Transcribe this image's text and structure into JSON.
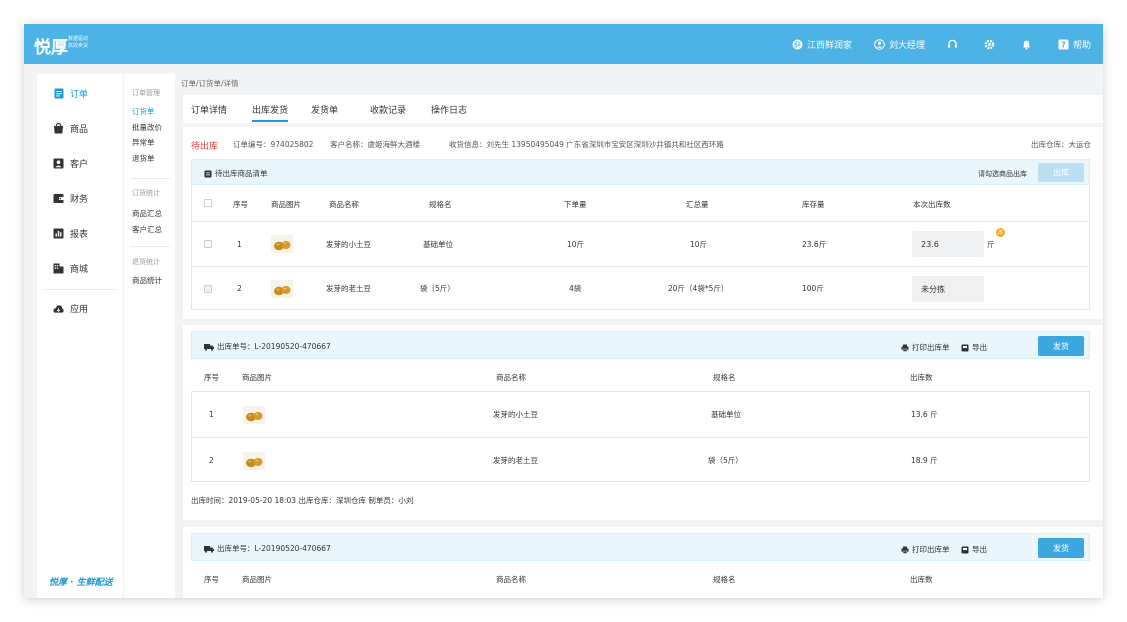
{
  "app": {
    "logo": "悦厚",
    "logo_sub_1": "数据驱动",
    "logo_sub_2": "高效卖货",
    "footer_brand": "悦厚 · 生鲜配送"
  },
  "topbar": {
    "store": "江西鲜润家",
    "user": "刘大经理",
    "help": "帮助"
  },
  "nav": {
    "items": [
      {
        "label": "订单",
        "icon": "order-icon"
      },
      {
        "label": "商品",
        "icon": "goods-icon"
      },
      {
        "label": "客户",
        "icon": "customer-icon"
      },
      {
        "label": "财务",
        "icon": "finance-icon"
      },
      {
        "label": "报表",
        "icon": "report-icon"
      },
      {
        "label": "商城",
        "icon": "mall-icon"
      },
      {
        "label": "应用",
        "icon": "cloud-icon"
      }
    ]
  },
  "subnav": {
    "group1_head": "订单管理",
    "group1": [
      "订货单",
      "批量改价",
      "异常单",
      "退货单"
    ],
    "group2_head": "订货统计",
    "group2": [
      "商品汇总",
      "客户汇总"
    ],
    "group3_head": "退货统计",
    "group3": [
      "商品统计"
    ]
  },
  "breadcrumb": "订单/订货单/详情",
  "tabs": [
    "订单详情",
    "出库发货",
    "发货单",
    "收款记录",
    "操作日志"
  ],
  "order": {
    "status": "待出库",
    "order_no": "订单编号：974025802",
    "customer": "客户名称：虞姬海鲜大酒楼",
    "receiver": "收货信息：刘先生 13950495049  广东省深圳市宝安区深圳沙井镇共和社区西环路",
    "warehouse": "出库仓库：大运仓"
  },
  "pending": {
    "title": "待出库商品清单",
    "hint": "请勾选商品出库",
    "button": "出库",
    "headers": [
      "序号",
      "商品图片",
      "商品名称",
      "规格名",
      "下单量",
      "汇总量",
      "库存量",
      "本次出库数"
    ],
    "rows": [
      {
        "no": "1",
        "name": "发芽的小土豆",
        "spec": "基础单位",
        "ordered": "10斤",
        "summary": "10斤",
        "stock": "23.6斤",
        "out": "23.6",
        "unit": "斤",
        "badge": "改"
      },
      {
        "no": "2",
        "name": "发芽的老土豆",
        "spec": "袋（5斤）",
        "ordered": "4袋",
        "summary": "20斤（4袋*5斤）",
        "stock": "100斤",
        "out": "未分拣",
        "unit": "",
        "badge": ""
      }
    ]
  },
  "shipments": [
    {
      "label": "出库单号：L-20190520-470667",
      "print": "打印出库单",
      "export": "导出",
      "button": "发货",
      "headers": [
        "序号",
        "商品图片",
        "商品名称",
        "规格名",
        "出库数"
      ],
      "rows": [
        {
          "no": "1",
          "name": "发芽的小土豆",
          "spec": "基础单位",
          "qty": "13.6  斤"
        },
        {
          "no": "2",
          "name": "发芽的老土豆",
          "spec": "袋（5斤）",
          "qty": "18.9  斤"
        }
      ],
      "footer": "出库时间：2019-05-20 18:03    出库仓库：深圳仓库    制单员：小刘"
    },
    {
      "label": "出库单号：L-20190520-470667",
      "print": "打印出库单",
      "export": "导出",
      "button": "发货",
      "headers": [
        "序号",
        "商品图片",
        "商品名称",
        "规格名",
        "出库数"
      ]
    }
  ]
}
